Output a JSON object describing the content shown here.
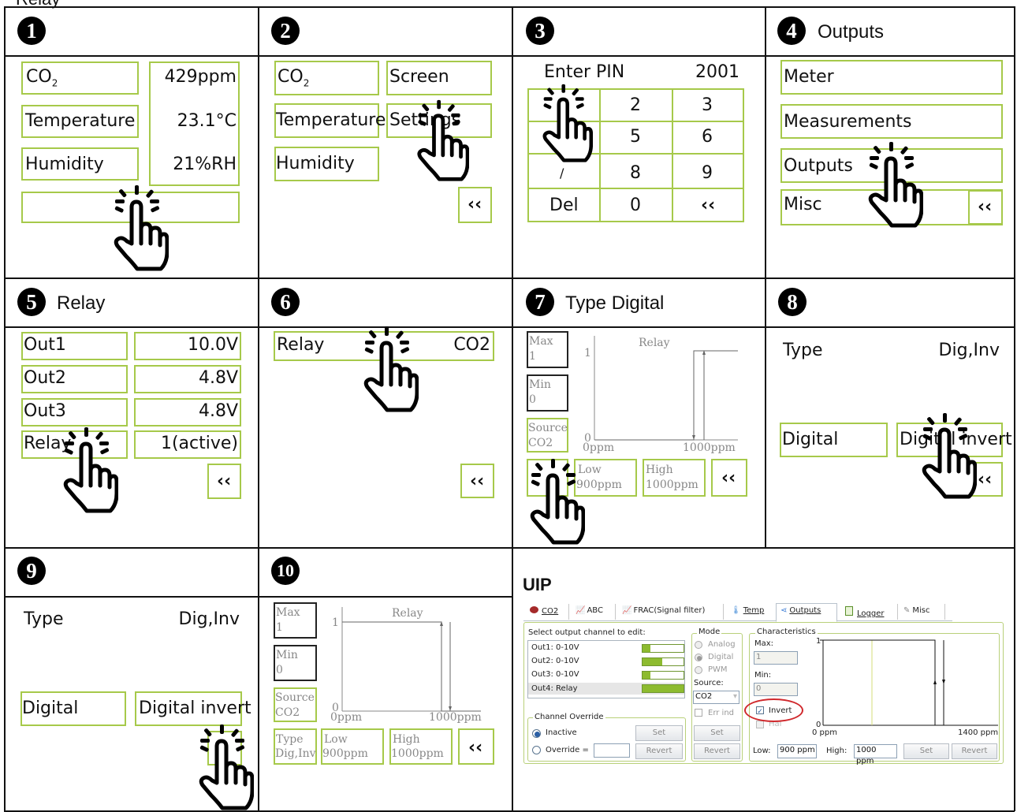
{
  "page_top_label": "Relay",
  "panels": {
    "p1": {
      "num": "1",
      "rows": [
        {
          "label": "CO",
          "sub": "2",
          "value": "429ppm"
        },
        {
          "label": "Temperature",
          "value": "23.1°C"
        },
        {
          "label": "Humidity",
          "value": "21%RH"
        }
      ]
    },
    "p2": {
      "num": "2",
      "left": [
        "CO",
        "Temperature",
        "Humidity"
      ],
      "co_sub": "2",
      "right": [
        "Screen",
        "Settings"
      ],
      "back": "‹‹"
    },
    "p3": {
      "num": "3",
      "pin_label": "Enter PIN",
      "pin_value": "2001",
      "keys": [
        "1",
        "2",
        "3",
        "4",
        "5",
        "6",
        "/",
        "8",
        "9",
        "Del",
        "0",
        "‹‹"
      ]
    },
    "p4": {
      "num": "4",
      "title": "Outputs",
      "items": [
        "Meter",
        "Measurements",
        "Outputs",
        "Misc"
      ],
      "back": "‹‹"
    },
    "p5": {
      "num": "5",
      "title": "Relay",
      "rows": [
        {
          "label": "Out1",
          "value": "10.0V"
        },
        {
          "label": "Out2",
          "value": "4.8V"
        },
        {
          "label": "Out3",
          "value": "4.8V"
        },
        {
          "label": "Relay",
          "value": "1(active)"
        }
      ],
      "back": "‹‹"
    },
    "p6": {
      "num": "6",
      "label": "Relay",
      "value": "CO2",
      "back": "‹‹"
    },
    "p7": {
      "num": "7",
      "title": "Type Digital",
      "max_label": "Max",
      "max_value": "1",
      "min_label": "Min",
      "min_value": "0",
      "source_label": "Source",
      "source_value": "CO2",
      "chart_title": "Relay",
      "y_top": "1",
      "y_bottom": "0",
      "x_left": "0ppm",
      "x_right": "1000ppm",
      "type_label": "Type",
      "type_value": "Digital",
      "low_label": "Low",
      "low_value": "900ppm",
      "high_label": "High",
      "high_value": "1000ppm",
      "back": "‹‹"
    },
    "p8": {
      "num": "8",
      "type_label": "Type",
      "type_value": "Dig,Inv",
      "opt1": "Digital",
      "opt2": "Digital invert",
      "back": "‹‹"
    },
    "p9": {
      "num": "9",
      "type_label": "Type",
      "type_value": "Dig,Inv",
      "opt1": "Digital",
      "opt2": "Digital invert"
    },
    "p10": {
      "num": "10",
      "max_label": "Max",
      "max_value": "1",
      "min_label": "Min",
      "min_value": "0",
      "source_label": "Source",
      "source_value": "CO2",
      "chart_title": "Relay",
      "y_top": "1",
      "y_bottom": "0",
      "x_left": "0ppm",
      "x_right": "1000ppm",
      "type_label": "Type",
      "type_value": "Dig,Inv",
      "low_label": "Low",
      "low_value": "900ppm",
      "high_label": "High",
      "high_value": "1000ppm",
      "back": "‹‹"
    }
  },
  "uip": {
    "title": "UIP",
    "tabs": [
      "CO2",
      "ABC",
      "FRAC(Signal filter)",
      "Temp",
      "Outputs",
      "Logger",
      "Misc"
    ],
    "select_label": "Select output channel to edit:",
    "channels": [
      {
        "name": "Out1: 0-10V",
        "level": 0.2
      },
      {
        "name": "Out2: 0-10V",
        "level": 0.48
      },
      {
        "name": "Out3: 0-10V",
        "level": 0.2
      },
      {
        "name": "Out4: Relay",
        "level": 1.0
      }
    ],
    "override_group": "Channel Override",
    "inactive": "Inactive",
    "override": "Override =",
    "set": "Set",
    "revert": "Revert",
    "mode_group": "Mode",
    "modes": [
      "Analog",
      "Digital",
      "PWM"
    ],
    "source_label": "Source:",
    "source_value": "CO2",
    "err_ind": "Err ind",
    "char_group": "Characteristics",
    "max_label": "Max:",
    "max_value": "1",
    "min_label": "Min:",
    "min_value": "0",
    "invert": "Invert",
    "hal": "Hal",
    "y_top": "1",
    "y_bottom": "0",
    "x_left": "0 ppm",
    "x_right": "1400 ppm",
    "low_label": "Low:",
    "low_value": "900 ppm",
    "high_label": "High:",
    "high_value": "1000 ppm",
    "colors": {
      "accent": "#a6c94a",
      "bar": "#8dbb2f",
      "highlight": "#d0282c"
    }
  }
}
